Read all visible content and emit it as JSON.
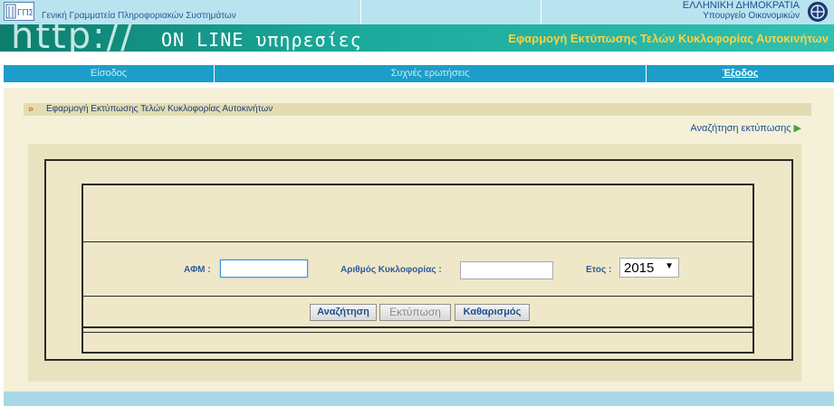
{
  "header": {
    "org_name": "Γενική Γραμματεία Πληροφοριακών Συστημάτων",
    "logo_text": "ΓΠΣ",
    "gov_line1": "ΕΛΛΗΝΙΚΗ ΔΗΜΟΚΡΑΤΙΑ",
    "gov_line2": "Υπουργείο Οικονομικών"
  },
  "banner": {
    "http_text": "http://",
    "online_text": "ON LINE υπηρεσίες",
    "app_title": "Εφαρμογή Εκτύπωσης Τελών Κυκλοφορίας Αυτοκινήτων"
  },
  "nav": {
    "items": [
      {
        "label": "Είσοδος"
      },
      {
        "label": "Συχνές ερωτήσεις"
      },
      {
        "label": "Έξοδος"
      }
    ]
  },
  "section": {
    "title": "Εφαρμογή Εκτύπωσης Τελών Κυκλοφορίας Αυτοκινήτων",
    "search_link": "Αναζήτηση εκτύπωσης"
  },
  "form": {
    "afm_label": "ΑΦΜ :",
    "afm_value": "",
    "plate_label": "Αριθμός Κυκλοφορίας :",
    "plate_value": "",
    "year_label": "Ετος :",
    "year_value": "2015"
  },
  "buttons": {
    "search": "Αναζήτηση",
    "print": "Εκτύπωση",
    "clear": "Καθαρισμός"
  },
  "colors": {
    "nav_bg": "#1b9ec9",
    "banner_accent": "#ffd23f",
    "form_bg": "#efe8c8"
  }
}
